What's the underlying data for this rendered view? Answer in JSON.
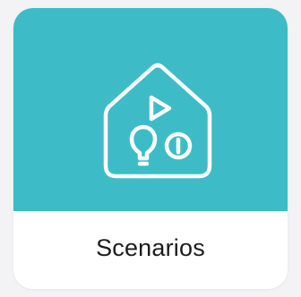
{
  "tile": {
    "label": "Scenarios",
    "icon": "house-scenario-icon",
    "accent_color": "#3dbcc7",
    "label_color": "#1c1c1e"
  }
}
